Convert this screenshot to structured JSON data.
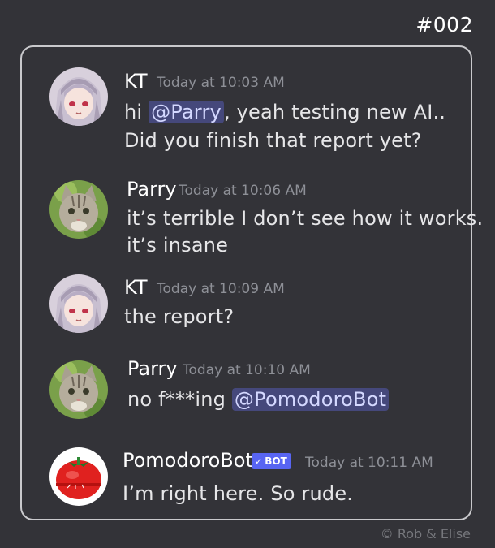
{
  "header": {
    "id": "#002"
  },
  "messages": [
    {
      "author": "KT",
      "time": "Today at 10:03 AM",
      "line1_pre": "hi ",
      "line1_mention": "@Parry",
      "line1_post": ", yeah testing new AI..",
      "line2": "Did you finish that report yet?"
    },
    {
      "author": "Parry",
      "time": "Today at 10:06 AM",
      "line1": "it’s terrible  I don’t see how it works.",
      "line2": "it’s insane"
    },
    {
      "author": "KT",
      "time": "Today at 10:09 AM",
      "line1": "the report?"
    },
    {
      "author": "Parry",
      "time": "Today at 10:10 AM",
      "line1_pre": "no f***ing ",
      "line1_mention": "@PomodoroBot "
    },
    {
      "author": "PomodoroBot",
      "badge": "BOT",
      "time": "Today at 10:11 AM",
      "line1": "I’m right here.  So rude."
    }
  ],
  "footer": {
    "copyright": "©  Rob & Elise"
  },
  "colors": {
    "background": "#333338",
    "mention_bg": "#45487b",
    "bot_badge": "#5865f2",
    "timestamp": "#8e9097"
  },
  "icons": [
    "kt-avatar-icon",
    "parry-cat-avatar-icon",
    "pomodoro-tomato-avatar-icon",
    "check-icon"
  ]
}
